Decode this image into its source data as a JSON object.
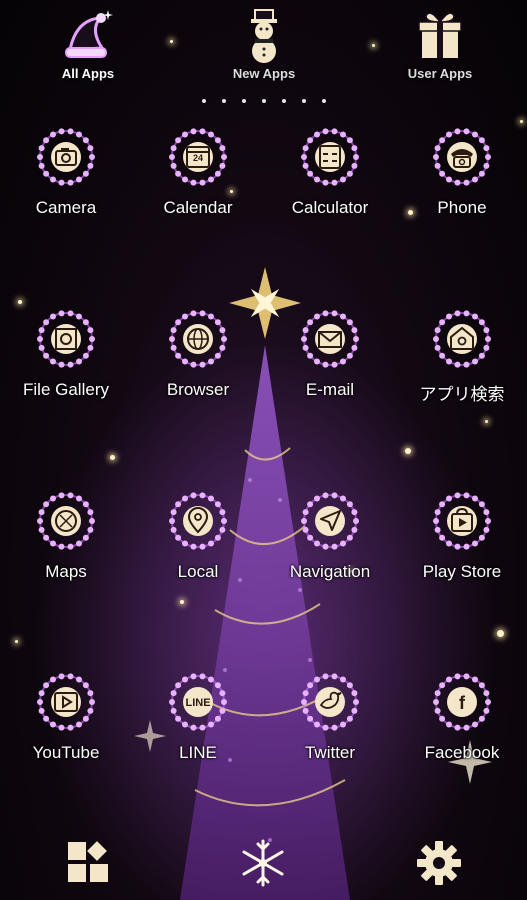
{
  "tabs": [
    {
      "label": "All Apps",
      "icon": "santa-hat-icon",
      "active": true
    },
    {
      "label": "New Apps",
      "icon": "snowman-icon",
      "active": false
    },
    {
      "label": "User Apps",
      "icon": "gift-icon",
      "active": false
    }
  ],
  "page_indicator": {
    "count": 7
  },
  "apps": [
    {
      "label": "Camera",
      "icon": "camera-icon"
    },
    {
      "label": "Calendar",
      "icon": "calendar-icon",
      "icon_text": "24"
    },
    {
      "label": "Calculator",
      "icon": "calculator-icon"
    },
    {
      "label": "Phone",
      "icon": "phone-icon"
    },
    {
      "label": "File Gallery",
      "icon": "gallery-icon"
    },
    {
      "label": "Browser",
      "icon": "globe-icon"
    },
    {
      "label": "E-mail",
      "icon": "mail-icon"
    },
    {
      "label": "アプリ検索",
      "icon": "app-search-icon"
    },
    {
      "label": "Maps",
      "icon": "map-icon"
    },
    {
      "label": "Local",
      "icon": "location-pin-icon"
    },
    {
      "label": "Navigation",
      "icon": "navigation-arrow-icon"
    },
    {
      "label": "Play Store",
      "icon": "play-store-icon"
    },
    {
      "label": "YouTube",
      "icon": "youtube-icon"
    },
    {
      "label": "LINE",
      "icon": "line-icon",
      "icon_text": "LINE"
    },
    {
      "label": "Twitter",
      "icon": "twitter-bird-icon"
    },
    {
      "label": "Facebook",
      "icon": "facebook-icon",
      "icon_text": "f"
    }
  ],
  "bottom_bar": {
    "left": {
      "icon": "widgets-icon"
    },
    "center": {
      "icon": "snowflake-icon"
    },
    "right": {
      "icon": "gear-icon"
    }
  },
  "colors": {
    "ring": "#c66bff",
    "ring_glow": "#e8b2ff",
    "icon_fill": "#f3e6c9",
    "icon_stroke": "#2a1a10",
    "tree": "#7a3fb0",
    "star": "#f4d27a"
  }
}
